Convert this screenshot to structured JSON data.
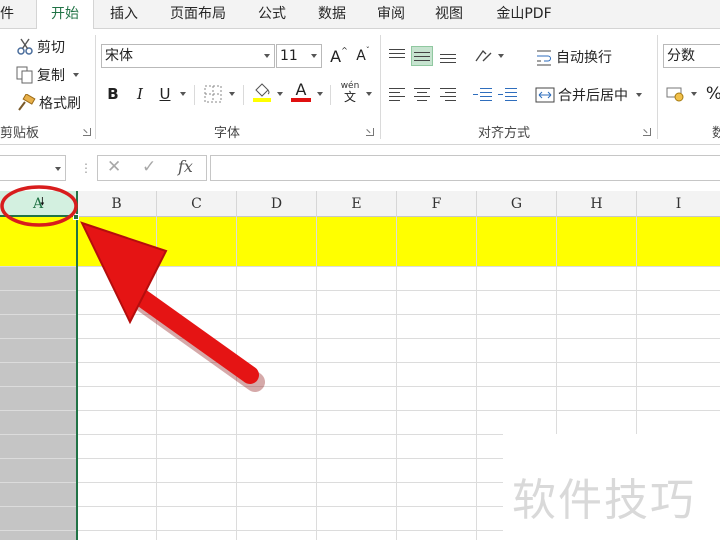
{
  "tabs": [
    {
      "label": "件",
      "active": false
    },
    {
      "label": "开始",
      "active": true
    },
    {
      "label": "插入",
      "active": false
    },
    {
      "label": "页面布局",
      "active": false
    },
    {
      "label": "公式",
      "active": false
    },
    {
      "label": "数据",
      "active": false
    },
    {
      "label": "审阅",
      "active": false
    },
    {
      "label": "视图",
      "active": false
    },
    {
      "label": "金山PDF",
      "active": false
    }
  ],
  "clipboard": {
    "cut_label": "剪切",
    "copy_label": "复制",
    "format_painter_label": "格式刷",
    "group_label": "剪贴板"
  },
  "font": {
    "name": "宋体",
    "size": "11",
    "grow_glyph": "A",
    "shrink_glyph": "A",
    "bold": "B",
    "italic": "I",
    "underline": "U",
    "font_color_glyph": "A",
    "font_color": "#e01010",
    "fill_color": "#ffff00",
    "phonetic_glyph": "wén",
    "group_label": "字体"
  },
  "alignment": {
    "wrap_label": "自动换行",
    "merge_label": "合并后居中",
    "group_label": "对齐方式",
    "selected_icon": "align-middle-icon"
  },
  "number": {
    "format": "分数",
    "percent_glyph": "%",
    "group_label_partial": "数"
  },
  "formula_bar": {
    "cancel_glyph": "✕",
    "enter_glyph": "✓",
    "fx_label": "fx",
    "value": ""
  },
  "columns": [
    {
      "label": "A",
      "selected": true
    },
    {
      "label": "B",
      "selected": false
    },
    {
      "label": "C",
      "selected": false
    },
    {
      "label": "D",
      "selected": false
    },
    {
      "label": "E",
      "selected": false
    },
    {
      "label": "F",
      "selected": false
    },
    {
      "label": "G",
      "selected": false
    },
    {
      "label": "H",
      "selected": false
    },
    {
      "label": "I",
      "selected": false
    }
  ],
  "highlight_row_color": "#ffff00",
  "annotation": {
    "circle_color": "#d81d1d",
    "arrow_color": "#e51414"
  },
  "watermark": "软件技巧"
}
